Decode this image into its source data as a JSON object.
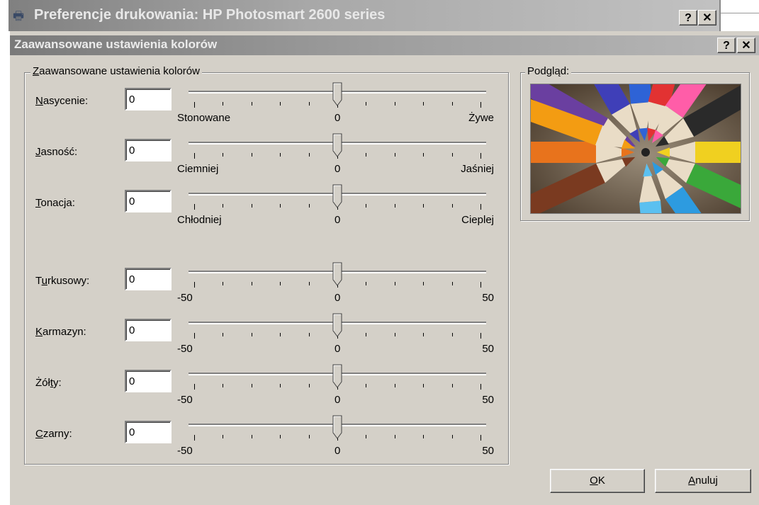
{
  "outer_window": {
    "title": "Preferencje drukowania: HP Photosmart 2600 series",
    "icon": "printer-icon",
    "help_label": "?",
    "close_label": "✕"
  },
  "dialog": {
    "title": "Zaawansowane ustawienia kolorów",
    "help_label": "?",
    "close_label": "✕"
  },
  "color_group": {
    "legend_first": "Z",
    "legend_rest": "aawansowane ustawienia kolorów",
    "sliders": [
      {
        "key": "nasycenie",
        "label_u": "N",
        "label_rest": "asycenie:",
        "value": "0",
        "slider_value": 0,
        "min_label": "Stonowane",
        "mid_label": "0",
        "max_label": "Żywe"
      },
      {
        "key": "jasnosc",
        "label_u": "J",
        "label_rest": "asność:",
        "value": "0",
        "slider_value": 0,
        "min_label": "Ciemniej",
        "mid_label": "0",
        "max_label": "Jaśniej"
      },
      {
        "key": "tonacja",
        "label_u": "T",
        "label_rest": "onacja:",
        "value": "0",
        "slider_value": 0,
        "min_label": "Chłodniej",
        "mid_label": "0",
        "max_label": "Cieplej"
      },
      {
        "key": "turkusowy",
        "label_pre": "T",
        "label_u": "u",
        "label_rest": "rkusowy:",
        "value": "0",
        "slider_value": 0,
        "min_label": "-50",
        "mid_label": "0",
        "max_label": "50"
      },
      {
        "key": "karmazyn",
        "label_u": "K",
        "label_rest": "armazyn:",
        "value": "0",
        "slider_value": 0,
        "min_label": "-50",
        "mid_label": "0",
        "max_label": "50"
      },
      {
        "key": "zolty",
        "label_pre": "Żół",
        "label_u": "t",
        "label_rest": "y:",
        "value": "0",
        "slider_value": 0,
        "min_label": "-50",
        "mid_label": "0",
        "max_label": "50"
      },
      {
        "key": "czarny",
        "label_u": "C",
        "label_rest": "zarny:",
        "value": "0",
        "slider_value": 0,
        "min_label": "-50",
        "mid_label": "0",
        "max_label": "50"
      }
    ]
  },
  "preview_group": {
    "legend": "Podgląd:",
    "image": "colored-pencils-photo"
  },
  "buttons": {
    "ok_u": "O",
    "ok_rest": "K",
    "cancel_u": "A",
    "cancel_rest": "nuluj"
  }
}
